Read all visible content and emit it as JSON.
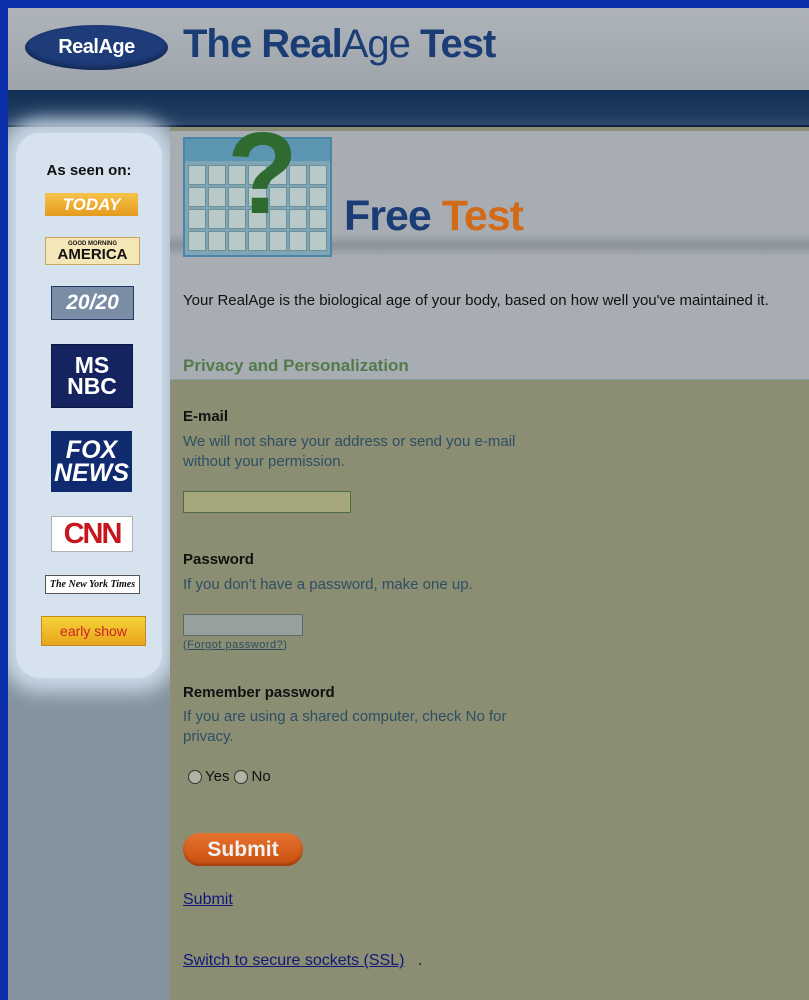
{
  "header": {
    "logo_text": "RealAge",
    "title_part1": "The Real",
    "title_part2": "Age",
    "title_part3": " Test"
  },
  "sidebar": {
    "seen_on_label": "As seen on:",
    "badges": [
      {
        "name": "today",
        "text": "TODAY"
      },
      {
        "name": "good-morning-america",
        "small": "GOOD MORNING",
        "large": "AMERICA"
      },
      {
        "name": "2020",
        "text": "20/20"
      },
      {
        "name": "msnbc",
        "line1": "MS",
        "line2": "NBC"
      },
      {
        "name": "fox-news",
        "line1": "FOX",
        "line2": "NEWS"
      },
      {
        "name": "cnn",
        "text": "CNN"
      },
      {
        "name": "nyt",
        "text": "The New York Times"
      },
      {
        "name": "early-show",
        "text": "early show"
      }
    ]
  },
  "main": {
    "banner": {
      "calendar_icon": "calendar-question-icon",
      "free_label": "Free ",
      "test_label": "Test"
    },
    "intro": "Your RealAge is the biological age of your body, based on how well you've maintained it.",
    "section_title": "Privacy and Personalization",
    "email": {
      "label": "E-mail",
      "hint": "We will not share your address or send you e-mail without your permission.",
      "value": ""
    },
    "password": {
      "label": "Password",
      "hint": "If you don't have a password, make one up.",
      "value": "",
      "forgot_open": "(",
      "forgot_link": "Forgot password?",
      "forgot_close": ")"
    },
    "remember": {
      "label": "Remember password",
      "hint": "If you are using a shared computer, check No for privacy.",
      "options": [
        "Yes",
        "No"
      ]
    },
    "submit_button": "Submit",
    "submit_link": "Submit",
    "ssl_link": "Switch to secure sockets (SSL)",
    "ssl_suffix": "."
  },
  "colors": {
    "page_border": "#0b2fa8",
    "brand_blue": "#1b3d75",
    "accent_orange": "#d26b18",
    "section_green": "#547a49",
    "form_bg": "#8b8e73"
  }
}
